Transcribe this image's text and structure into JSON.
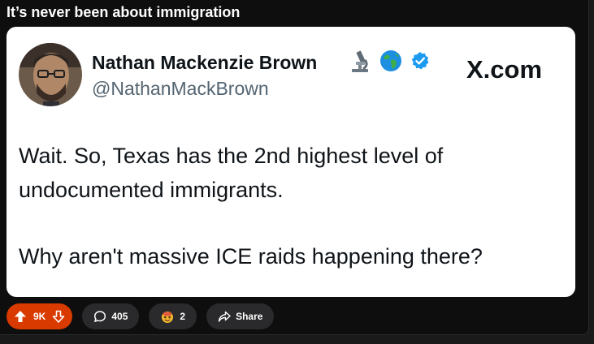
{
  "post": {
    "title": "It’s never been about immigration"
  },
  "embed": {
    "author_name": "Nathan Mackenzie Brown",
    "handle": "@NathanMackBrown",
    "source": "X.com",
    "badges": [
      "microscope-icon",
      "globe-icon",
      "verified-icon"
    ],
    "text": [
      "Wait. So, Texas has the 2nd highest level of undocumented immigrants.",
      "Why aren't massive ICE raids happening there?"
    ]
  },
  "actions": {
    "votes": "9K",
    "comments": "405",
    "awards": "2",
    "share": "Share"
  },
  "colors": {
    "upvote_pill": "#d93a00",
    "verified": "#1d9bf0",
    "card": "#ffffff",
    "background": "#0e0e0f"
  }
}
